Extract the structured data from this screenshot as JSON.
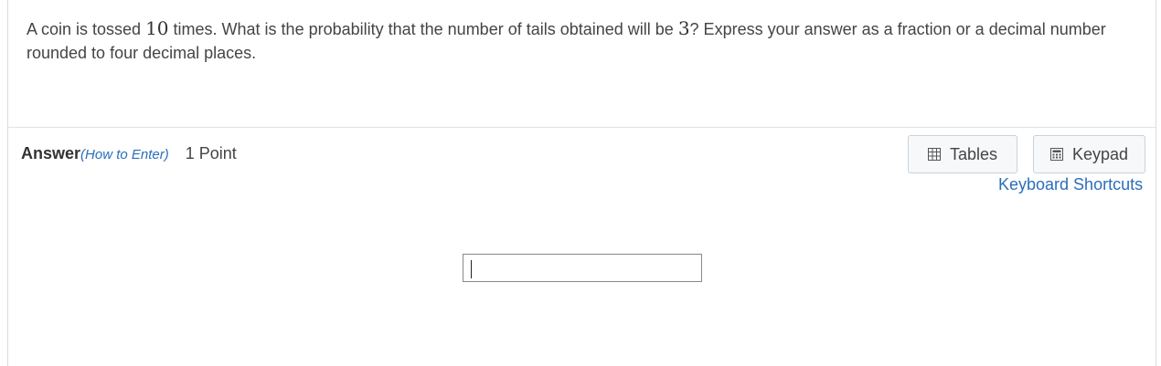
{
  "question": {
    "part1": "A coin is tossed ",
    "n": "10",
    "part2": " times. What is the probability that the number of tails obtained will be ",
    "k": "3",
    "part3": "? Express your answer as a fraction or a decimal number rounded to four decimal places."
  },
  "answer": {
    "label": "Answer",
    "how_to_enter": "(How to Enter)",
    "points": "1 Point",
    "input_value": ""
  },
  "tools": {
    "tables_label": "Tables",
    "keypad_label": "Keypad",
    "shortcuts_label": "Keyboard Shortcuts"
  },
  "colors": {
    "link": "#2a6ebb",
    "button_bg": "#f6f8fa",
    "button_border": "#c9d2da"
  },
  "icons": {
    "tables": "table-grid-icon",
    "keypad": "calculator-icon"
  }
}
